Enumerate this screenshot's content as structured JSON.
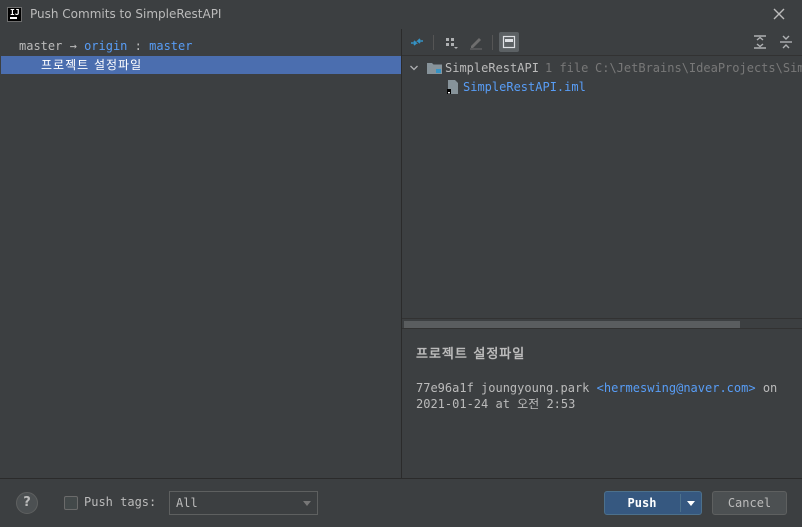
{
  "window": {
    "title": "Push Commits to SimpleRestAPI",
    "app_icon": "intellij-app-icon",
    "close_icon": "close-icon"
  },
  "commits_panel": {
    "local_branch": "master",
    "arrow": "→",
    "remote": "origin",
    "separator": ":",
    "remote_branch": "master",
    "commits": [
      {
        "message": "프로젝트 설정파일",
        "selected": true
      }
    ]
  },
  "changes_panel": {
    "toolbar": [
      {
        "name": "show-diff-icon"
      },
      {
        "name": "group-by-icon"
      },
      {
        "name": "edit-source-icon"
      },
      {
        "name": "preview-diff-icon",
        "active": true
      },
      {
        "name": "expand-all-icon"
      },
      {
        "name": "collapse-all-icon"
      }
    ],
    "tree": {
      "root": {
        "name": "SimpleRestAPI",
        "count": "1 file",
        "path": "C:\\JetBrains\\IdeaProjects\\SimpleRestAPI"
      },
      "files": [
        {
          "name": "SimpleRestAPI.iml"
        }
      ]
    }
  },
  "commit_details": {
    "title": "프로젝트 설정파일",
    "hash": "77e96a1f",
    "author": "joungyoung.park",
    "email": "<hermeswing@naver.com>",
    "on_label": "on",
    "date": "2021-01-24 at 오전 2:53"
  },
  "bottom": {
    "help_label": "?",
    "push_tags_label": "Push tags:",
    "push_tags_checked": false,
    "tags_select_value": "All",
    "push_label": "Push",
    "cancel_label": "Cancel"
  },
  "colors": {
    "background": "#3c3f41",
    "selection": "#4b6eaf",
    "link": "#589df6",
    "primary_button": "#365880"
  }
}
